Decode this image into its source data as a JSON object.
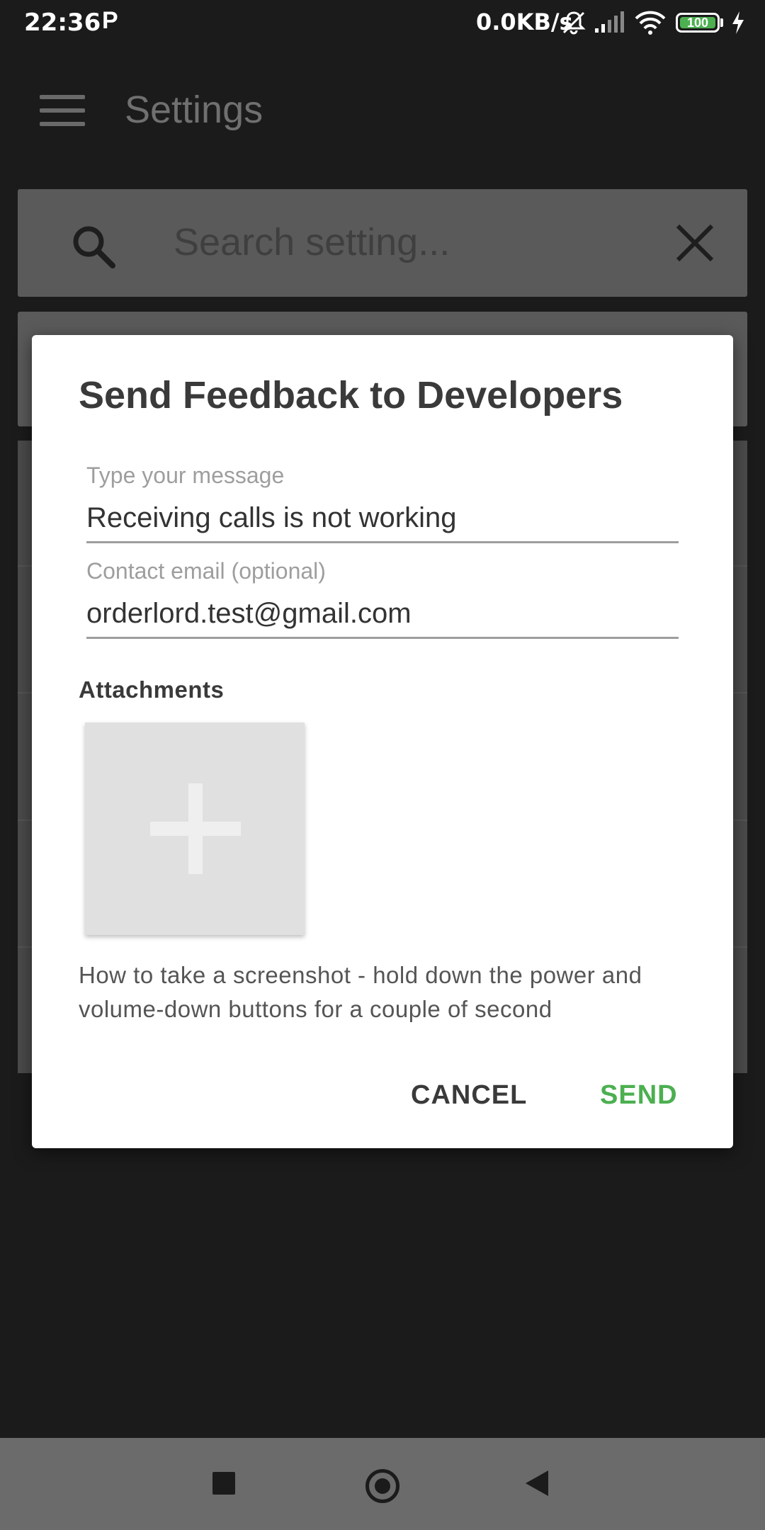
{
  "status_bar": {
    "time": "22:36",
    "notification_letter": "P",
    "network_speed": "0.0KB/s",
    "battery": "100",
    "battery_color": "#4caf50",
    "icons": [
      "mute-bell-icon",
      "signal-icon",
      "wifi-icon",
      "battery-icon",
      "charging-icon"
    ]
  },
  "app_bar": {
    "title": "Settings",
    "menu_icon": "hamburger-menu-icon"
  },
  "search": {
    "placeholder": "Search setting...",
    "search_icon": "search-icon",
    "clear_icon": "close-icon"
  },
  "dialog": {
    "title": "Send Feedback to Developers",
    "message_label": "Type your message",
    "message_value": "Receiving calls is not working",
    "email_label": "Contact email (optional)",
    "email_value": "orderlord.test@gmail.com",
    "attachments_label": "Attachments",
    "add_attachment_icon": "plus-icon",
    "hint": "How to take a screenshot - hold down the power and volume-down buttons for a couple of second",
    "cancel_label": "CANCEL",
    "send_label": "SEND",
    "accent_color": "#4caf50"
  },
  "nav_bar": {
    "icons": [
      "recents-square-icon",
      "home-circle-icon",
      "back-triangle-icon"
    ]
  }
}
